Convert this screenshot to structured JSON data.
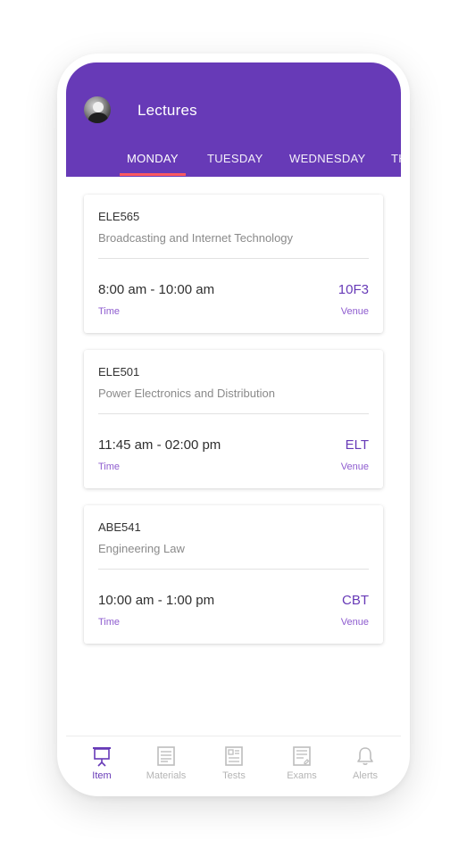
{
  "header": {
    "title": "Lectures"
  },
  "tabs": [
    {
      "label": "MONDAY",
      "active": true
    },
    {
      "label": "TUESDAY"
    },
    {
      "label": "WEDNESDAY"
    },
    {
      "label": "TH"
    }
  ],
  "lectures": [
    {
      "code": "ELE565",
      "name": "Broadcasting and Internet Technology",
      "time": "8:00 am - 10:00 am",
      "venue": "10F3",
      "time_label": "Time",
      "venue_label": "Venue"
    },
    {
      "code": "ELE501",
      "name": "Power Electronics and Distribution",
      "time": "11:45 am - 02:00 pm",
      "venue": "ELT",
      "time_label": "Time",
      "venue_label": "Venue"
    },
    {
      "code": "ABE541",
      "name": "Engineering Law",
      "time": "10:00 am - 1:00 pm",
      "venue": "CBT",
      "time_label": "Time",
      "venue_label": "Venue"
    }
  ],
  "bottom_nav": [
    {
      "label": "Item",
      "icon": "presentation-icon",
      "active": true
    },
    {
      "label": "Materials",
      "icon": "document-icon"
    },
    {
      "label": "Tests",
      "icon": "document-lines-icon"
    },
    {
      "label": "Exams",
      "icon": "document-edit-icon"
    },
    {
      "label": "Alerts",
      "icon": "bell-icon"
    }
  ],
  "colors": {
    "primary": "#673ab7",
    "tab_indicator": "#ff5a5f",
    "accent_text": "#8e5ccf",
    "inactive_nav": "#b5b5b5"
  }
}
